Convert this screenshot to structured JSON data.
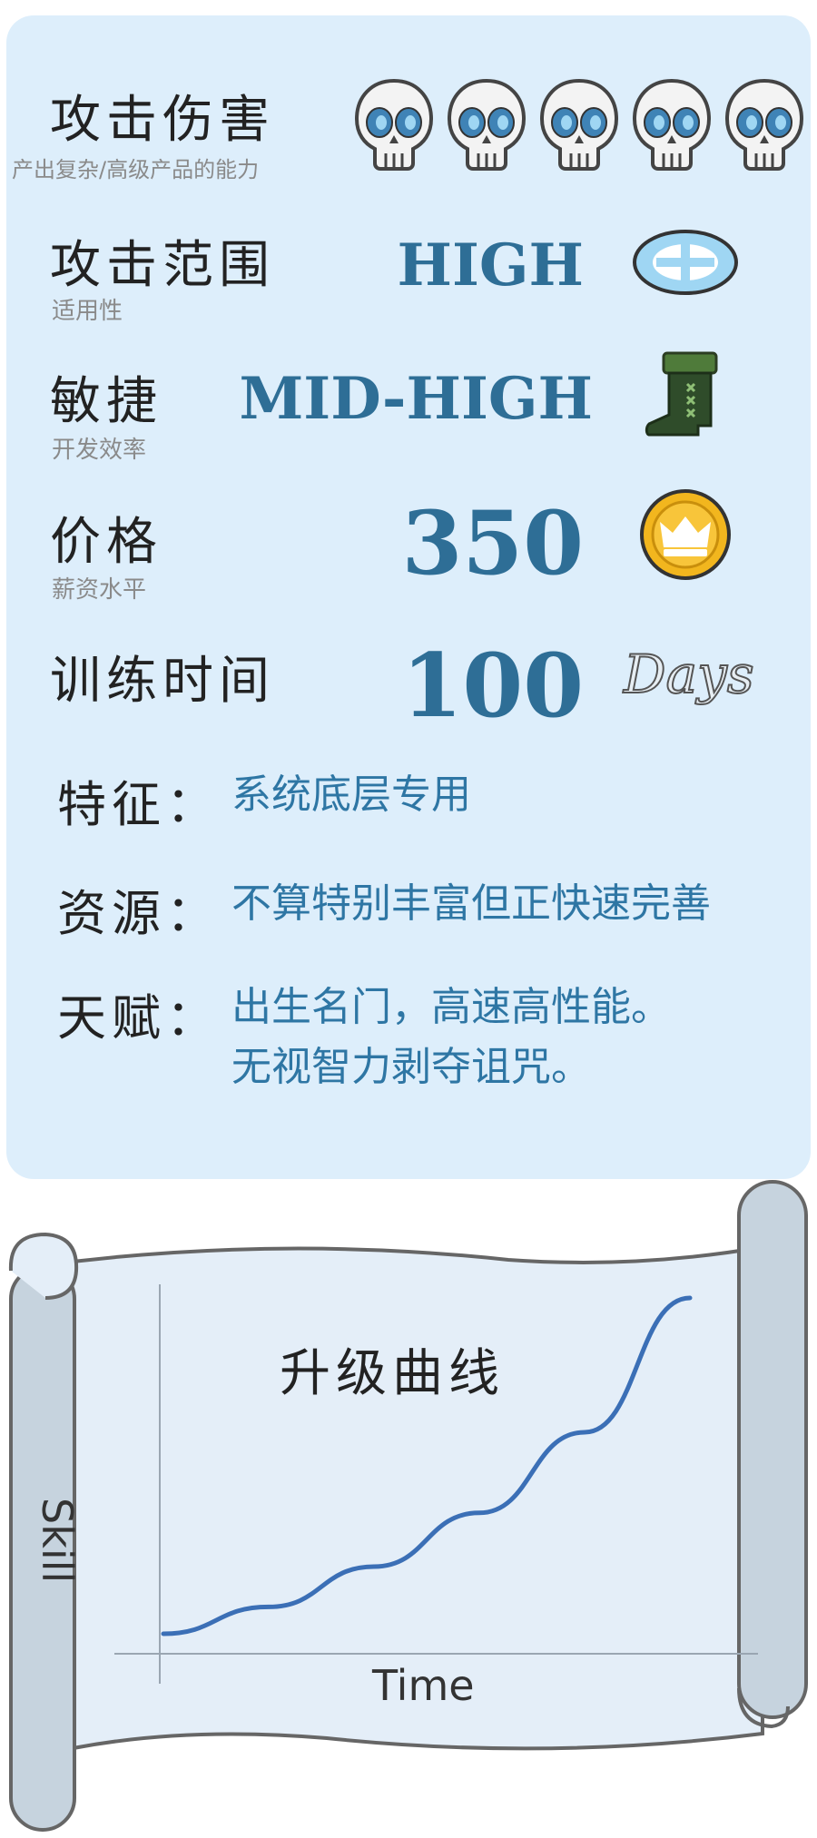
{
  "stats": {
    "attack": {
      "title": "攻击伤害",
      "subtitle": "产出复杂/高级产品的能力",
      "skulls": 5,
      "icon": "skull-icon"
    },
    "range": {
      "title": "攻击范围",
      "subtitle": "适用性",
      "value": "HIGH",
      "icon": "crosshair-icon"
    },
    "agility": {
      "title": "敏捷",
      "subtitle": "开发效率",
      "value": "MID-HIGH",
      "icon": "boot-icon"
    },
    "price": {
      "title": "价格",
      "subtitle": "薪资水平",
      "value": "350",
      "icon": "crown-coin-icon"
    },
    "training": {
      "title": "训练时间",
      "value": "100",
      "unit": "Days"
    }
  },
  "traits": {
    "feature": {
      "label": "特征：",
      "text": "系统底层专用"
    },
    "resources": {
      "label": "资源：",
      "text": "不算特别丰富但正快速完善"
    },
    "talent": {
      "label": "天赋：",
      "line1": "出生名门，高速高性能。",
      "line2": "无视智力剥夺诅咒。"
    }
  },
  "chart_data": {
    "type": "line",
    "title": "升级曲线",
    "xlabel": "Time",
    "ylabel": "Skill",
    "series": [
      {
        "x": [
          0,
          0.2,
          0.4,
          0.6,
          0.8,
          1.0
        ],
        "y": [
          0,
          0.08,
          0.2,
          0.36,
          0.6,
          1.0
        ]
      }
    ]
  },
  "colors": {
    "card": "#ddeefb",
    "value": "#2e6e96",
    "curve": "#3b6fb6",
    "scroll": "#e4eef8",
    "roller": "#c6d3de"
  }
}
